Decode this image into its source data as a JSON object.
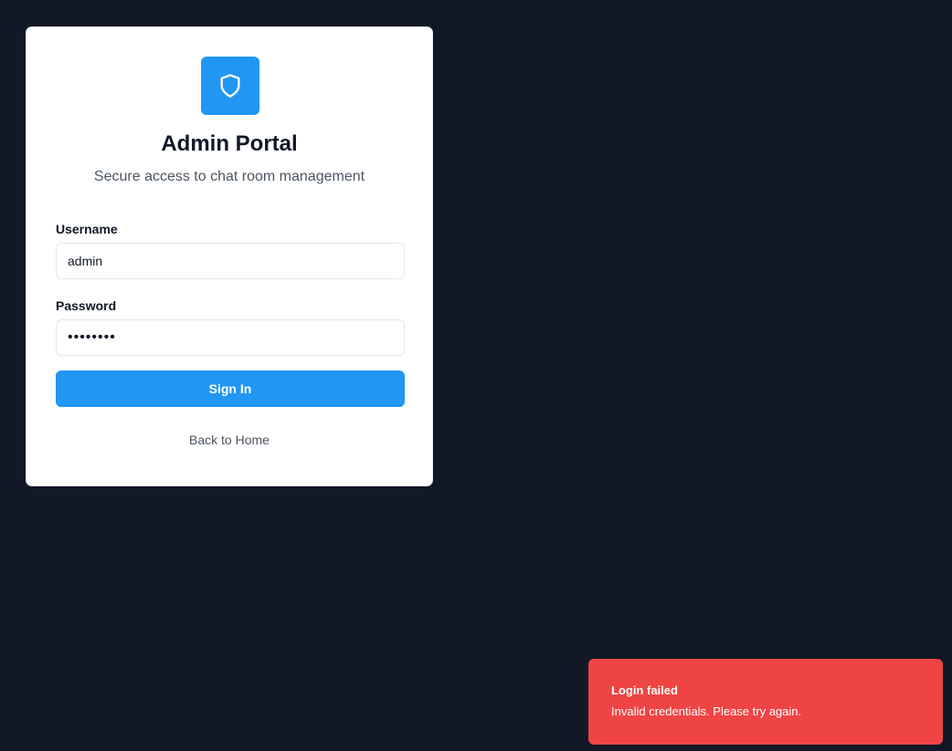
{
  "login": {
    "title": "Admin Portal",
    "subtitle": "Secure access to chat room management",
    "username_label": "Username",
    "username_value": "admin",
    "password_label": "Password",
    "password_value": "••••••••",
    "signin_label": "Sign In",
    "back_label": "Back to Home",
    "logo_icon": "shield-icon"
  },
  "toast": {
    "title": "Login failed",
    "description": "Invalid credentials. Please try again."
  },
  "colors": {
    "background": "#111827",
    "primary": "#2196f3",
    "error": "#ef4444",
    "card": "#ffffff"
  }
}
